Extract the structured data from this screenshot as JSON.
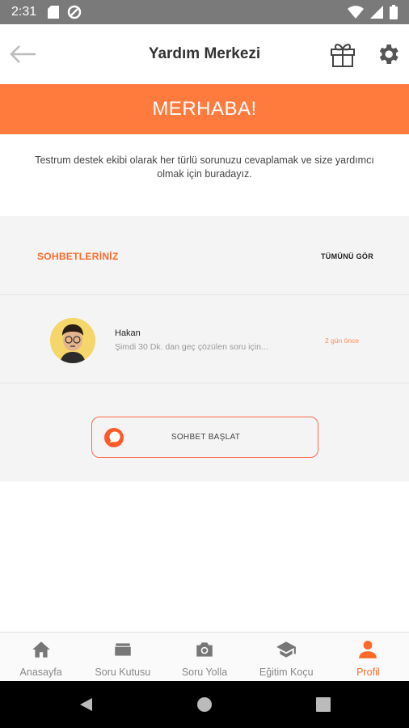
{
  "status_bar": {
    "time": "2:31"
  },
  "app_bar": {
    "title": "Yardım Merkezi"
  },
  "banner": {
    "text": "MERHABA!"
  },
  "intro": {
    "text": "Testrum destek ekibi olarak her türlü sorunuzu cevaplamak ve size yardımcı olmak için buradayız."
  },
  "chats": {
    "title": "SOHBETLERİNİZ",
    "see_all": "TÜMÜNÜ GÖR",
    "items": [
      {
        "name": "Hakan",
        "message": "Şimdi 30 Dk. dan geç çözülen soru için...",
        "time_ago": "2 gün önce"
      }
    ],
    "start_label": "SOHBET BAŞLAT"
  },
  "bottom_nav": {
    "items": [
      {
        "label": "Anasayfa",
        "icon": "home-icon"
      },
      {
        "label": "Soru Kutusu",
        "icon": "inbox-icon"
      },
      {
        "label": "Soru Yolla",
        "icon": "camera-icon"
      },
      {
        "label": "Eğitim Koçu",
        "icon": "graduation-cap-icon"
      },
      {
        "label": "Profil",
        "icon": "person-icon"
      }
    ],
    "active": "Profil"
  },
  "colors": {
    "accent": "#ff7a3d",
    "status_bar": "#7a7a7a"
  }
}
